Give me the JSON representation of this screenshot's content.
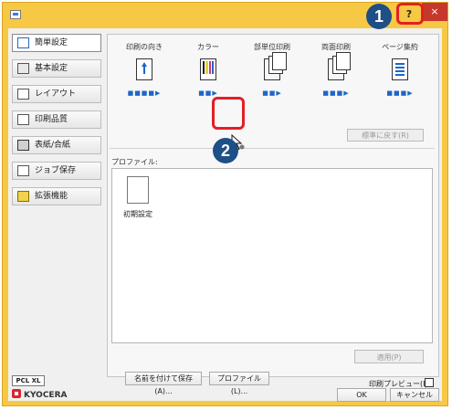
{
  "window": {
    "title": "",
    "help_label": "?",
    "close_label": "×"
  },
  "callouts": [
    "1",
    "2"
  ],
  "sidebar": {
    "items": [
      {
        "label": "簡単設定",
        "icon": "quick-settings-icon"
      },
      {
        "label": "基本設定",
        "icon": "basic-settings-icon"
      },
      {
        "label": "レイアウト",
        "icon": "layout-icon"
      },
      {
        "label": "印刷品質",
        "icon": "print-quality-icon"
      },
      {
        "label": "表紙/合紙",
        "icon": "cover-icon"
      },
      {
        "label": "ジョブ保存",
        "icon": "job-storage-icon"
      },
      {
        "label": "拡張機能",
        "icon": "advanced-icon"
      }
    ]
  },
  "quick": {
    "columns": [
      {
        "label": "印刷の向き",
        "icon": "orientation-icon"
      },
      {
        "label": "カラー",
        "icon": "color-icon"
      },
      {
        "label": "部単位印刷",
        "icon": "collate-icon"
      },
      {
        "label": "両面印刷",
        "icon": "duplex-icon"
      },
      {
        "label": "ページ集約",
        "icon": "pages-per-sheet-icon"
      }
    ],
    "reset_label": "標準に戻す(R)"
  },
  "profile": {
    "section_label": "プロファイル:",
    "items": [
      {
        "label": "初期設定"
      }
    ],
    "apply_label": "適用(P)"
  },
  "footer": {
    "pcl_label": "PCL XL",
    "brand": "KYOCERA",
    "save_as_label": "名前を付けて保存(A)...",
    "profile_label": "プロファイル(L)...",
    "preview_label": "印刷プレビュー(I)",
    "ok_label": "OK",
    "cancel_label": "キャンセル"
  },
  "colors": {
    "titlebar": "#f7c843",
    "close": "#c7372b",
    "callout": "#1e4f86",
    "highlight": "#e21f26",
    "accent": "#1e66c7"
  }
}
